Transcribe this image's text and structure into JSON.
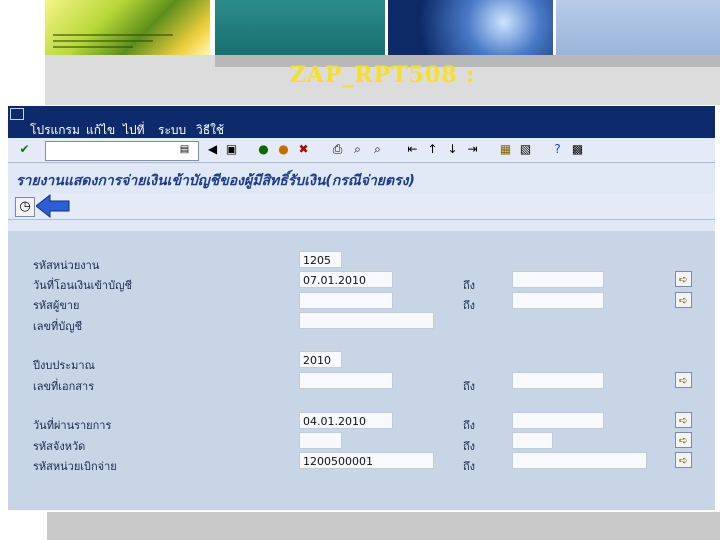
{
  "slide": {
    "title": "ZAP_RPT508 :"
  },
  "menubar": {
    "items": [
      "โปรแกรม",
      "แก้ไข",
      "ไปที่",
      "ระบบ",
      "วิธีใช้"
    ]
  },
  "toolbar": {
    "command_field_value": "",
    "icons": [
      "enter-icon",
      "dropdown-icon",
      "back-arrow-icon",
      "save-icon",
      "back-icon",
      "exit-icon",
      "cancel-icon",
      "print-icon",
      "find-icon",
      "find-next-icon",
      "first-page-icon",
      "previous-page-icon",
      "next-page-icon",
      "last-page-icon",
      "create-session-icon",
      "shortcut-icon",
      "help-icon",
      "layout-icon"
    ]
  },
  "screen": {
    "title": "รายงานแสดงการจ่ายเงินเข้าบัญชีของผู้มีสิทธิ์รับเงิน(กรณีจ่ายตรง)"
  },
  "app_toolbar": {
    "execute_icon": "clock-execute-icon"
  },
  "form": {
    "to_label": "ถึง",
    "rows": [
      {
        "label": "รหัสหน่วยงาน",
        "value": ""
      },
      {
        "label": "วันที่โอนเงินเข้าบัญชี",
        "value": "07.01.2010",
        "to_value": ""
      },
      {
        "label": "รหัสผู้ขาย",
        "value": "",
        "to_value": ""
      },
      {
        "label": "เลขที่บัญชี",
        "value": ""
      },
      {
        "label": "ปีงบประมาณ",
        "value": "2010"
      },
      {
        "label": "เลขที่เอกสาร",
        "value": "",
        "to_value": ""
      },
      {
        "label": "วันที่ผ่านรายการ",
        "value": "04.01.2010",
        "to_value": ""
      },
      {
        "label": "รหัสจังหวัด",
        "value": "",
        "to_value": ""
      },
      {
        "label": "รหัสหน่วยเบิกจ่าย",
        "value": "1200500001",
        "to_value": ""
      }
    ],
    "row0_value": "1205"
  },
  "colors": {
    "menubar": "#0d2a6c",
    "window": "#dfe8f4",
    "form_area": "#c7d5e7",
    "title_text": "#1e3c8c",
    "slide_title": "#f5df2a"
  }
}
